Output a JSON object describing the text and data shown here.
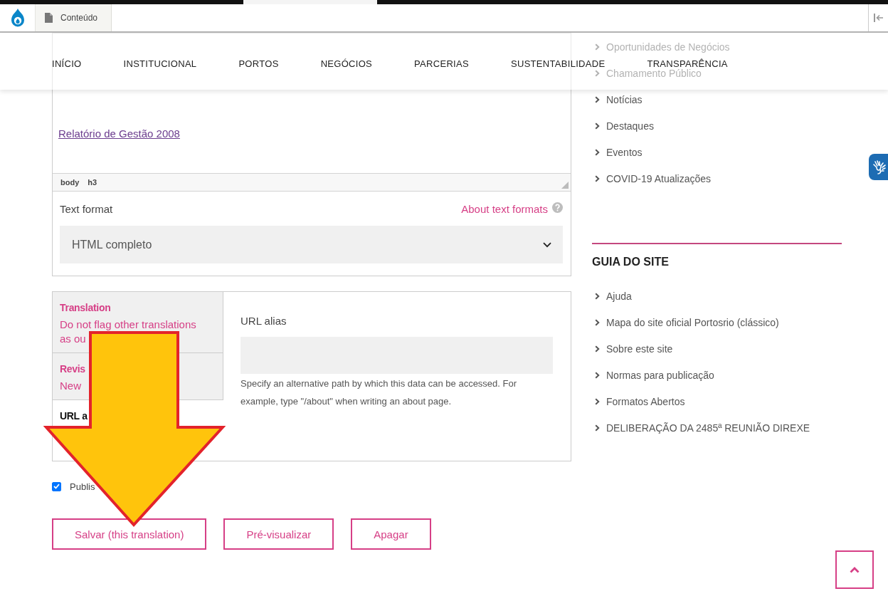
{
  "toolbar": {
    "tab": "Conteúdo"
  },
  "nav": {
    "items": [
      "INÍCIO",
      "INSTITUCIONAL",
      "PORTOS",
      "NEGÓCIOS",
      "PARCERIAS",
      "SUSTENTABILIDADE",
      "TRANSPARÊNCIA"
    ]
  },
  "editor": {
    "link": "Relatório de Gestão 2008",
    "element_path": [
      "body",
      "h3"
    ],
    "format": {
      "label": "Text format",
      "help": "About text formats",
      "value": "HTML completo"
    }
  },
  "vertical_tabs": {
    "tabs": [
      {
        "title": "Translation",
        "summary": "Do not flag other translations as ou",
        "selected": false
      },
      {
        "title": "Revis",
        "summary": "New",
        "selected": false
      },
      {
        "title": "URL a",
        "selected": true
      }
    ],
    "pane": {
      "label": "URL alias",
      "description": "Specify an alternative path by which this data can be accessed. For example, type \"/about\" when writing an about page."
    }
  },
  "published": {
    "label": "Publis",
    "checked": true
  },
  "actions": [
    "Salvar (this translation)",
    "Pré-visualizar",
    "Apagar"
  ],
  "sidebar": {
    "menu": [
      "Oportunidades de Negócios",
      "Chamamento Público",
      "Notícias",
      "Destaques",
      "Eventos",
      "COVID-19 Atualizações"
    ],
    "guide": {
      "title": "GUIA DO SITE",
      "items": [
        "Ajuda",
        "Mapa do site oficial Portosrio (clássico)",
        "Sobre este site",
        "Normas para publicação",
        "Formatos Abertos",
        "DELIBERAÇÃO DA 2485ª REUNIÃO DIREXE"
      ]
    }
  }
}
